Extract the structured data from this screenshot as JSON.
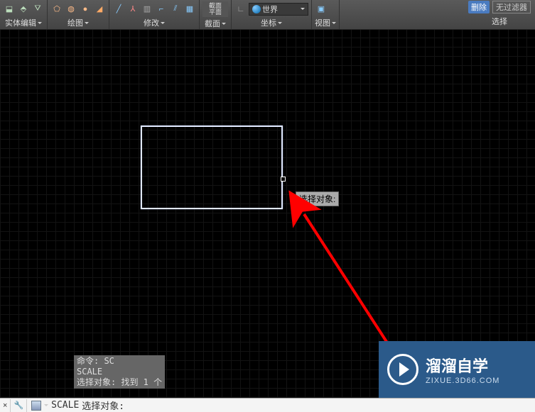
{
  "ribbon": {
    "groups": {
      "solid_edit": {
        "label": "实体编辑"
      },
      "draw": {
        "label": "绘图"
      },
      "modify": {
        "label": "修改"
      },
      "section": {
        "label": "截面",
        "big_label_1": "截面",
        "big_label_2": "平面"
      },
      "coords": {
        "label": "坐标",
        "world_label": "世界"
      },
      "view": {
        "label": "视图"
      },
      "select": {
        "label": "选择",
        "btn_delete": "删除",
        "btn_filter": "无过滤器"
      }
    }
  },
  "canvas": {
    "tooltip_text": "选择对象:"
  },
  "cmd_history": {
    "line1": "命令: SC",
    "line2": "SCALE",
    "line3": "选择对象: 找到 1 个"
  },
  "cmd_line": {
    "close_symbol": "×",
    "command": "SCALE",
    "prompt": "选择对象:"
  },
  "watermark": {
    "title": "溜溜自学",
    "sub": "ZIXUE.3D66.COM"
  }
}
